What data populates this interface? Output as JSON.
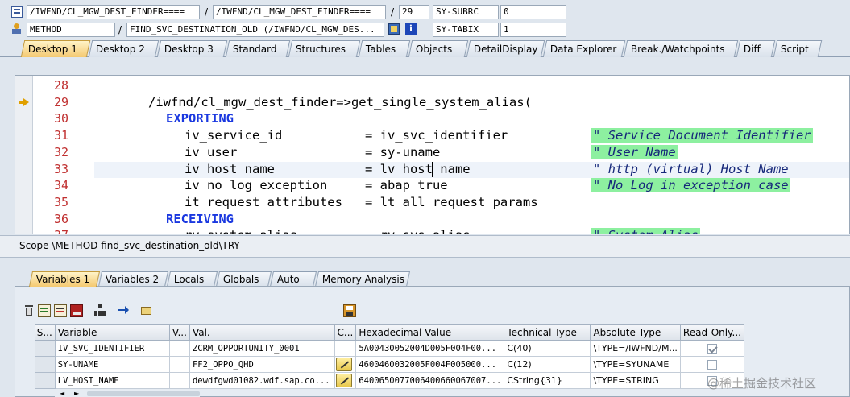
{
  "header": {
    "row1": {
      "program": "/IWFND/CL_MGW_DEST_FINDER====",
      "include": "/IWFND/CL_MGW_DEST_FINDER====",
      "line": "29",
      "var_name": "SY-SUBRC",
      "var_value": "0"
    },
    "row2": {
      "type": "METHOD",
      "method": "FIND_SVC_DESTINATION_OLD (/IWFND/CL_MGW_DES...",
      "var_name": "SY-TABIX",
      "var_value": "1"
    },
    "slash": "/"
  },
  "desktop_tabs": [
    "Desktop 1",
    "Desktop 2",
    "Desktop 3",
    "Standard",
    "Structures",
    "Tables",
    "Objects",
    "DetailDisplay",
    "Data Explorer",
    "Break./Watchpoints",
    "Diff",
    "Script"
  ],
  "code": {
    "line_numbers": [
      "28",
      "29",
      "30",
      "31",
      "32",
      "33",
      "34",
      "35",
      "36",
      "37"
    ],
    "lines": [
      "",
      "/iwfnd/cl_mgw_dest_finder=>get_single_system_alias(",
      "EXPORTING",
      "iv_service_id           = iv_svc_identifier",
      "iv_user                 = sy-uname",
      "iv_host_name            = lv_host_name",
      "iv_no_log_exception     = abap_true",
      "it_request_attributes   = lt_all_request_params",
      "RECEIVING",
      "rv_system_alias         = rv_sys_alias"
    ],
    "comments": [
      "\" Service Document Identifier",
      "\" User Name",
      "\" http (virtual) Host Name",
      "\" No Log in exception case",
      "\" System Alias"
    ]
  },
  "scope": "Scope \\METHOD find_svc_destination_old\\TRY",
  "var_tabs": [
    "Variables 1",
    "Variables 2",
    "Locals",
    "Globals",
    "Auto",
    "Memory Analysis"
  ],
  "grid": {
    "columns": [
      "S...",
      "Variable",
      "V...",
      "Val.",
      "C...",
      "Hexadecimal Value",
      "Technical Type",
      "Absolute Type",
      "Read-Only..."
    ],
    "rows": [
      {
        "variable": "IV_SVC_IDENTIFIER",
        "value": "ZCRM_OPPORTUNITY_0001",
        "hex": "5A00430052004D005F004F00...",
        "tech": "C(40)",
        "abs": "\\TYPE=/IWFND/M...",
        "readonly": true,
        "editable": false
      },
      {
        "variable": "SY-UNAME",
        "value": "FF2_OPPO_QHD",
        "hex": "4600460032005F004F005000...",
        "tech": "C(12)",
        "abs": "\\TYPE=SYUNAME",
        "readonly": false,
        "editable": true
      },
      {
        "variable": "LV_HOST_NAME",
        "value": "dewdfgwd01082.wdf.sap.co...",
        "hex": "6400650077006400660067007...",
        "tech": "CString{31}",
        "abs": "\\TYPE=STRING",
        "readonly": false,
        "editable": true
      }
    ]
  },
  "watermark": "@稀土掘金技术社区"
}
